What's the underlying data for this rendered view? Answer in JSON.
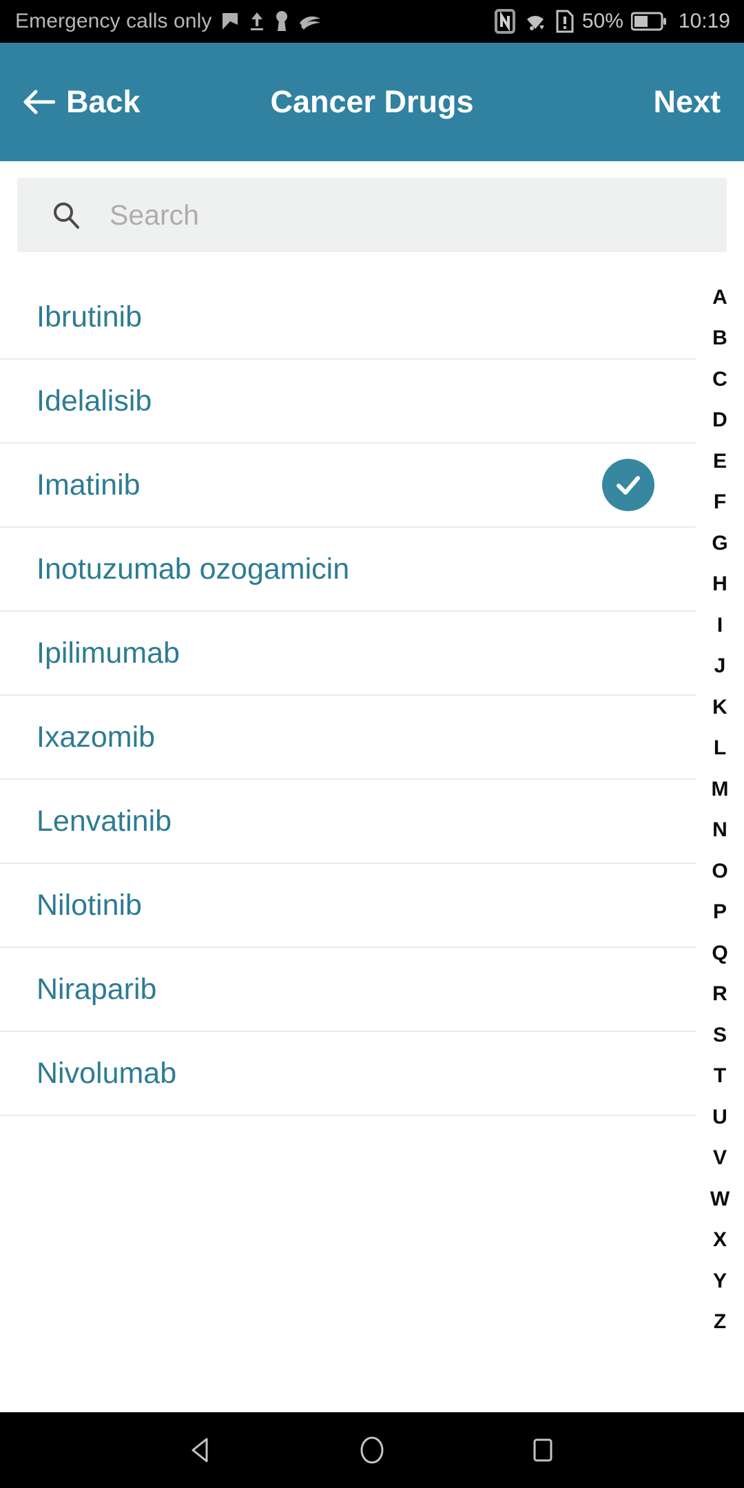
{
  "status_bar": {
    "carrier": "Emergency calls only",
    "battery_percent": "50%",
    "time": "10:19",
    "icons": [
      "mail-icon",
      "upload-icon",
      "keyhole-icon",
      "swiftkey-icon",
      "nfc-icon",
      "wifi-icon",
      "sim-alert-icon",
      "battery-icon"
    ]
  },
  "app_bar": {
    "back_label": "Back",
    "title": "Cancer Drugs",
    "next_label": "Next",
    "background_color": "#3182a0",
    "text_color": "#ffffff"
  },
  "search": {
    "placeholder": "Search",
    "value": "",
    "icon": "search-icon",
    "background_color": "#eff0f0"
  },
  "list": {
    "accent_color": "#2d7c93",
    "selected_badge_color": "#3787a0",
    "items": [
      {
        "label": "Ibrutinib",
        "selected": false
      },
      {
        "label": "Idelalisib",
        "selected": false
      },
      {
        "label": "Imatinib",
        "selected": true
      },
      {
        "label": "Inotuzumab ozogamicin",
        "selected": false
      },
      {
        "label": "Ipilimumab",
        "selected": false
      },
      {
        "label": "Ixazomib",
        "selected": false
      },
      {
        "label": "Lenvatinib",
        "selected": false
      },
      {
        "label": "Nilotinib",
        "selected": false
      },
      {
        "label": "Niraparib",
        "selected": false
      },
      {
        "label": "Nivolumab",
        "selected": false
      }
    ]
  },
  "alpha_index": {
    "letters": [
      "A",
      "B",
      "C",
      "D",
      "E",
      "F",
      "G",
      "H",
      "I",
      "J",
      "K",
      "L",
      "M",
      "N",
      "O",
      "P",
      "Q",
      "R",
      "S",
      "T",
      "U",
      "V",
      "W",
      "X",
      "Y",
      "Z"
    ]
  },
  "nav_bar": {
    "buttons": [
      "back-triangle-icon",
      "home-circle-icon",
      "recents-square-icon"
    ]
  }
}
